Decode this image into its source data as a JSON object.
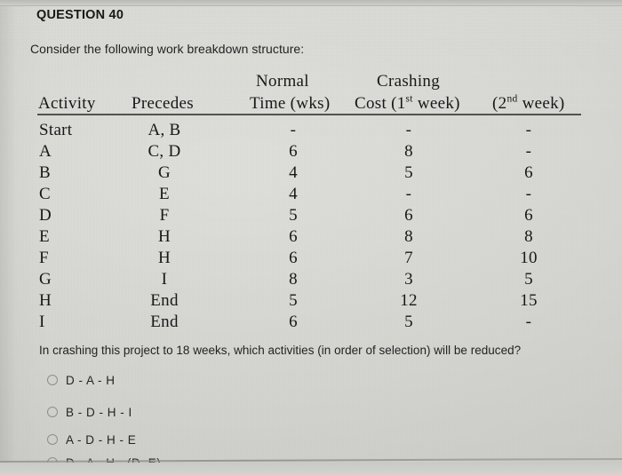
{
  "question": {
    "title": "QUESTION 40",
    "prompt": "Consider the following work breakdown structure:",
    "sub_question": "In crashing this project to 18 weeks, which activities (in order of selection) will be reduced?"
  },
  "table": {
    "group_headers": {
      "normal": "Normal",
      "crashing": "Crashing"
    },
    "columns": [
      {
        "key": "activity",
        "label": "Activity"
      },
      {
        "key": "precedes",
        "label": "Precedes"
      },
      {
        "key": "time",
        "label": "Time (wks)"
      },
      {
        "key": "cost1",
        "label": "Cost (1",
        "sup": "st",
        "label_tail": " week)"
      },
      {
        "key": "cost2",
        "label": "(2",
        "sup": "nd",
        "label_tail": " week)"
      }
    ],
    "rows": [
      {
        "activity": "Start",
        "precedes": "A, B",
        "time": "-",
        "cost1": "-",
        "cost2": "-"
      },
      {
        "activity": "A",
        "precedes": "C, D",
        "time": "6",
        "cost1": "8",
        "cost2": "-"
      },
      {
        "activity": "B",
        "precedes": "G",
        "time": "4",
        "cost1": "5",
        "cost2": "6"
      },
      {
        "activity": "C",
        "precedes": "E",
        "time": "4",
        "cost1": "-",
        "cost2": "-"
      },
      {
        "activity": "D",
        "precedes": "F",
        "time": "5",
        "cost1": "6",
        "cost2": "6"
      },
      {
        "activity": "E",
        "precedes": "H",
        "time": "6",
        "cost1": "8",
        "cost2": "8"
      },
      {
        "activity": "F",
        "precedes": "H",
        "time": "6",
        "cost1": "7",
        "cost2": "10"
      },
      {
        "activity": "G",
        "precedes": "I",
        "time": "8",
        "cost1": "3",
        "cost2": "5"
      },
      {
        "activity": "H",
        "precedes": "End",
        "time": "5",
        "cost1": "12",
        "cost2": "15"
      },
      {
        "activity": "I",
        "precedes": "End",
        "time": "6",
        "cost1": "5",
        "cost2": "-"
      }
    ]
  },
  "options": [
    {
      "label": "D - A - H",
      "selected": false
    },
    {
      "label": "B - D - H - I",
      "selected": false
    },
    {
      "label": "A - D - H - E",
      "selected": false
    },
    {
      "label": "D - A - H - (D, E)",
      "selected": false
    }
  ],
  "colors": {
    "page_background": "#d5d5d3",
    "text": "#1b1b1b",
    "rule": "#3a3a3a",
    "radio_outline": "#8e8e8a"
  }
}
